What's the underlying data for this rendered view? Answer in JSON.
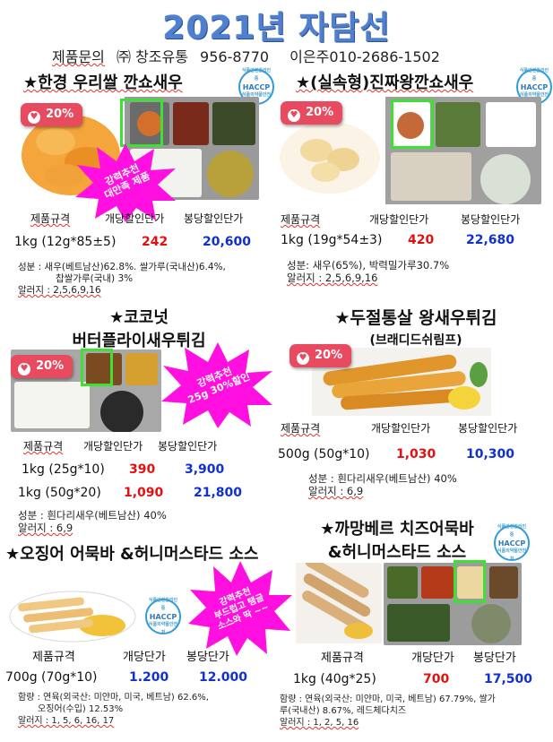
{
  "title": "2021년 자담선",
  "contact": {
    "label": "제품문의",
    "company": "㈜ 창조유통",
    "company_phone": "956-8770",
    "person": "이은주",
    "person_phone": "010-2686-1502"
  },
  "haccp": {
    "top": "식품안전관리인증",
    "main": "HACCP",
    "bottom": "식품의약품안전처"
  },
  "products": [
    {
      "name": "★한경 우리쌀 깐쇼새우",
      "discount": "20%",
      "burst": "강력추천\n대만족 제품",
      "headers": [
        "제품규격",
        "개당할인단가",
        "봉당할인단가"
      ],
      "rows": [
        {
          "spec": "1kg (12g*85±5)",
          "unit": "242",
          "pack": "20,600"
        }
      ],
      "ingredients": [
        "성분 : 새우(베트남산)62.8%. 쌀가루(국내산)6.4%,",
        "찹쌀가루(국내) 3%"
      ],
      "allergy": "알러지 : 2,5,6,9,16"
    },
    {
      "name": "★(실속형)진짜왕깐쇼새우",
      "discount": "20%",
      "headers": [
        "제품규격",
        "개당할인단가",
        "봉당할인단가"
      ],
      "rows": [
        {
          "spec": "1kg (19g*54±3)",
          "unit": "420",
          "pack": "22,680"
        }
      ],
      "ingredients": [
        "성분: 새우(65%), 박력밀가루30.7%"
      ],
      "allergy": "알러지 : 2,5,6,9,16"
    },
    {
      "name_line1": "★코코넛",
      "name_line2": "버터플라이새우튀김",
      "discount": "20%",
      "burst": "강력추천\n25g 30%할인",
      "headers": [
        "제품규격",
        "개당할인단가",
        "봉당할인단가"
      ],
      "rows": [
        {
          "spec": "1kg (25g*10)",
          "unit": "390",
          "pack": "3,900"
        },
        {
          "spec": "1kg (50g*20)",
          "unit": "1,090",
          "pack": "21,800"
        }
      ],
      "ingredients": [
        "성분 : 흰다리새우(베트남산) 40%"
      ],
      "allergy": "알러지 : 6,9"
    },
    {
      "name_line1": "★두절통살 왕새우튀김",
      "name_line2": "(브래디드쉬림프)",
      "discount": "20%",
      "headers": [
        "제품규격",
        "개당할인단가",
        "봉당할인단가"
      ],
      "rows": [
        {
          "spec": "500g (50g*10)",
          "unit": "1,030",
          "pack": "10,300"
        }
      ],
      "ingredients": [
        "성분 : 흰다리새우(베트남산) 40%"
      ],
      "allergy": "알러지 : 6,9"
    },
    {
      "name": "★오징어 어묵바 &허니머스타드 소스",
      "burst": "강력추천\n부드럽고 탱글\n소스와 딱 ~~",
      "headers": [
        "제품규격",
        "개당단가",
        "봉당단가"
      ],
      "rows": [
        {
          "spec": "700g (70g*10)",
          "unit": "1.200",
          "pack": "12.000"
        }
      ],
      "ingredients": [
        "함량 : 연육(외국산: 미얀마, 미국, 베트남) 62.6%,",
        "오징어(수입) 12.53%"
      ],
      "allergy": "알러지 : 1, 5, 6, 16, 17"
    },
    {
      "name_line1": "★까망베르 치즈어묵바",
      "name_line2": "&허니머스타드 소스",
      "headers": [
        "제품규격",
        "개당단가",
        "봉당단가"
      ],
      "rows": [
        {
          "spec": "1kg (40g*25)",
          "unit": "700",
          "pack": "17,500"
        }
      ],
      "ingredients": [
        "함량 : 연육(외국산: 미얀마, 미국, 베트남) 67.79%, 쌀가",
        "루(국내산) 8.67%, 레드체다치즈"
      ],
      "allergy": "알러지 : 1, 2, 5, 16"
    }
  ],
  "colors": {
    "title": "#4f7fcf",
    "badge": "#e84a5f",
    "burst": "#ff10e0",
    "price_red": "#e21010",
    "price_blue": "#1030d0",
    "highlight": "#3ee033"
  }
}
